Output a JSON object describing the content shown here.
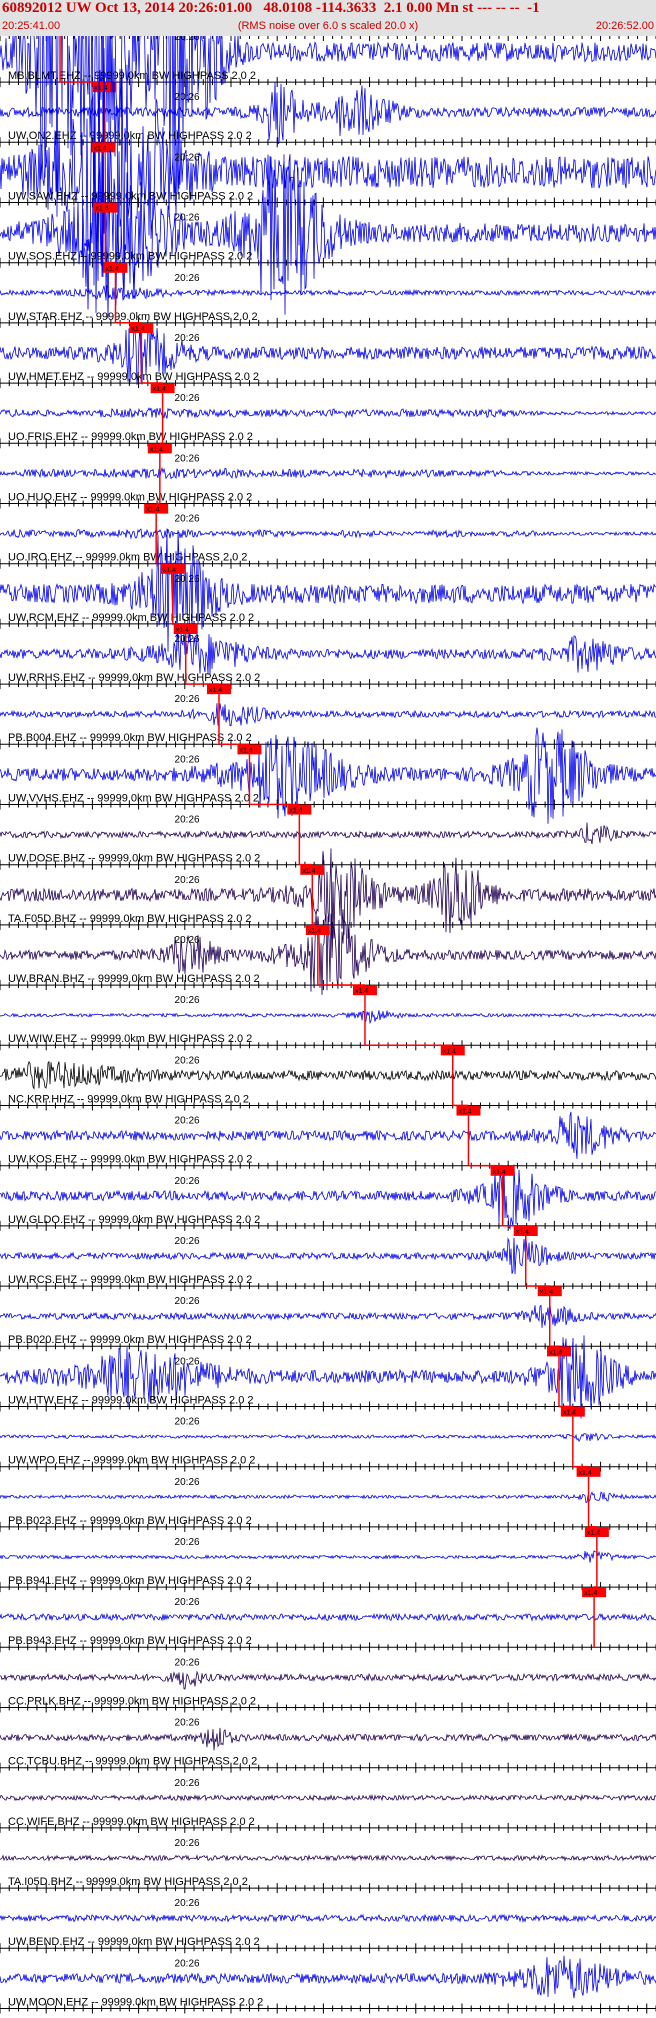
{
  "header": {
    "title": "60892012 UW Oct 13, 2014 20:26:01.00   48.0108 -114.3633  2.1 0.00 Mn st --- -- --  -1",
    "start_time": "20:25:41.00",
    "end_time": "20:26:52.00",
    "subtitle": "(RMS noise over 6.0 s scaled 20.0 x)"
  },
  "chart_data": {
    "type": "line",
    "title": "60892012 UW Oct 13, 2014 20:26:01.00   48.0108 -114.3633  2.1 0.00 Mn st --- -- --  -1",
    "subtitle": "(RMS noise over 6.0 s scaled 20.0 x)",
    "x_range_seconds": [
      0,
      71
    ],
    "x_start_label": "20:25:41.00",
    "x_end_label": "20:26:52.00",
    "minute_label": "20:26",
    "minute_mark_seconds": 19,
    "tick_interval_seconds": 1,
    "pick_label": "x1.4",
    "colors": {
      "blue": "#0000ee",
      "purple": "#220055",
      "black": "#000000",
      "pick": "#ff0000"
    },
    "traces": [
      {
        "station": "MB.BLMT.EHZ",
        "label": "MB.BLMT.EHZ -- 99999.0km BW  HIGHPASS  2.0  2",
        "color": "blue",
        "pick_seconds": 6.5,
        "amp": 6,
        "events": [
          [
            5.5,
            9,
            18
          ],
          [
            11,
            10,
            10
          ],
          [
            19,
            10,
            14
          ]
        ]
      },
      {
        "station": "UW.ON2.EHZ",
        "label": "UW.ON2.EHZ -- 99999.0km BW  HIGHPASS  2.0  2",
        "color": "blue",
        "pick_seconds": 11.3,
        "amp": 3,
        "events": [
          [
            30,
            6,
            6
          ],
          [
            38,
            10,
            5
          ]
        ]
      },
      {
        "station": "UW.SAW.EHZ",
        "label": "UW.SAW.EHZ -- 99999.0km BW  HIGHPASS  2.0  2",
        "color": "blue",
        "pick_seconds": 11.2,
        "amp": 10,
        "events": [
          [
            11.2,
            16,
            8
          ]
        ]
      },
      {
        "station": "UW.SOS.EHZ",
        "label": "UW.SOS.EHZ -- 99999.0km BW  HIGHPASS  2.0  2",
        "color": "blue",
        "pick_seconds": 11.4,
        "amp": 6,
        "events": [
          [
            11.4,
            14,
            8
          ],
          [
            30,
            12,
            8
          ]
        ]
      },
      {
        "station": "UW.STAR.EHZ",
        "label": "UW.STAR.EHZ -- 99999.0km BW  HIGHPASS  2.0  2",
        "color": "blue",
        "pick_seconds": 12.5,
        "amp": 1.5,
        "events": [
          [
            12.3,
            14,
            2
          ]
        ]
      },
      {
        "station": "UW.HMET.EHZ",
        "label": "UW.HMET.EHZ -- 99999.0km BW  HIGHPASS  2.0  2",
        "color": "blue",
        "pick_seconds": 15.3,
        "amp": 4,
        "events": [
          [
            15,
            10,
            4
          ]
        ]
      },
      {
        "station": "UO.FRIS.EHZ",
        "label": "UO.FRIS.EHZ -- 99999.0km BW  HIGHPASS  2.0  2",
        "color": "blue",
        "pick_seconds": 17.6,
        "amp": 1,
        "events": [
          [
            2,
            12,
            1.5
          ],
          [
            12,
            12,
            1.5
          ],
          [
            18,
            14,
            2
          ],
          [
            25,
            10,
            1
          ],
          [
            30,
            12,
            1
          ],
          [
            37,
            10,
            1.5
          ],
          [
            44,
            14,
            1.5
          ],
          [
            50,
            10,
            1
          ],
          [
            54,
            10,
            1
          ]
        ]
      },
      {
        "station": "UO.HUQ.EHZ",
        "label": "UO.HUQ.EHZ -- 99999.0km BW  HIGHPASS  2.0  2",
        "color": "blue",
        "pick_seconds": 17.3,
        "amp": 1,
        "events": [
          [
            4,
            12,
            1.5
          ],
          [
            12,
            12,
            1.5
          ],
          [
            18,
            16,
            2
          ],
          [
            25,
            10,
            1.5
          ],
          [
            32,
            10,
            1.5
          ],
          [
            40,
            12,
            1.5
          ],
          [
            46,
            10,
            1
          ],
          [
            52,
            10,
            1
          ]
        ]
      },
      {
        "station": "UO.IRO.EHZ",
        "label": "UO.IRO.EHZ -- 99999.0km BW  HIGHPASS  2.0  2",
        "color": "blue",
        "pick_seconds": 16.9,
        "amp": 1,
        "events": [
          [
            2,
            8,
            1.5
          ],
          [
            8,
            8,
            1.5
          ],
          [
            14,
            8,
            1.5
          ],
          [
            18,
            10,
            2
          ],
          [
            28,
            8,
            1.5
          ],
          [
            38,
            8,
            1.5
          ],
          [
            48,
            8,
            1.5
          ],
          [
            56,
            8,
            1
          ]
        ]
      },
      {
        "station": "UW.RCM.EHZ",
        "label": "UW.RCM.EHZ -- 99999.0km BW  HIGHPASS  2.0  2",
        "color": "blue",
        "pick_seconds": 18.7,
        "amp": 6,
        "events": [
          [
            18.5,
            10,
            6
          ]
        ]
      },
      {
        "station": "UW.RRHS.EHZ",
        "label": "UW.RRHS.EHZ -- 99999.0km BW  HIGHPASS  2.0  2",
        "color": "blue",
        "pick_seconds": 20.1,
        "amp": 3,
        "events": [
          [
            20.5,
            14,
            4
          ],
          [
            63,
            10,
            3
          ]
        ]
      },
      {
        "station": "PB.B004.EHZ",
        "label": "PB.B004.EHZ -- 99999.0km BW  HIGHPASS  2.0  2",
        "color": "blue",
        "pick_seconds": 23.7,
        "amp": 2,
        "events": [
          [
            24.5,
            10,
            3
          ]
        ]
      },
      {
        "station": "UW.VVHS.EHZ",
        "label": "UW.VVHS.EHZ -- 99999.0km BW  HIGHPASS  2.0  2",
        "color": "blue",
        "pick_seconds": 27.0,
        "amp": 4,
        "events": [
          [
            30,
            16,
            6
          ],
          [
            59,
            12,
            7
          ]
        ]
      },
      {
        "station": "UW.DOSE.BHZ",
        "label": "UW.DOSE.BHZ -- 99999.0km BW  HIGHPASS  2.0  2",
        "color": "purple",
        "pick_seconds": 32.4,
        "amp": 2,
        "events": [
          [
            64,
            5,
            3
          ]
        ]
      },
      {
        "station": "TA.F05D.BHZ",
        "label": "TA.F05D.BHZ -- 99999.0km BW  HIGHPASS  2.0  2",
        "color": "purple",
        "pick_seconds": 33.8,
        "amp": 4,
        "events": [
          [
            36,
            10,
            7
          ],
          [
            49,
            8,
            6
          ]
        ]
      },
      {
        "station": "UW.BRAN.BHZ",
        "label": "UW.BRAN.BHZ -- 99999.0km BW  HIGHPASS  2.0  2",
        "color": "purple",
        "pick_seconds": 34.4,
        "amp": 3,
        "events": [
          [
            20,
            8,
            4
          ],
          [
            35,
            12,
            8
          ]
        ]
      },
      {
        "station": "UW.WIW.EHZ",
        "label": "UW.WIW.EHZ -- 99999.0km BW  HIGHPASS  2.0  2",
        "color": "blue",
        "pick_seconds": 39.5,
        "amp": 1,
        "events": [
          [
            40,
            6,
            4
          ]
        ]
      },
      {
        "station": "NC.KRP.HHZ",
        "label": "NC.KRP.HHZ -- 99999.0km BW  HIGHPASS  2.0  2",
        "color": "black",
        "pick_seconds": 49.0,
        "amp": 3,
        "events": [
          [
            5,
            20,
            2
          ]
        ]
      },
      {
        "station": "UW.KOS.EHZ",
        "label": "UW.KOS.EHZ -- 99999.0km BW  HIGHPASS  2.0  2",
        "color": "blue",
        "pick_seconds": 50.7,
        "amp": 3,
        "events": [
          [
            62,
            10,
            4
          ]
        ]
      },
      {
        "station": "UW.GLDO.EHZ",
        "label": "UW.GLDO.EHZ -- 99999.0km BW  HIGHPASS  2.0  2",
        "color": "blue",
        "pick_seconds": 54.4,
        "amp": 3,
        "events": [
          [
            55,
            10,
            6
          ]
        ]
      },
      {
        "station": "UW.RCS.EHZ",
        "label": "UW.RCS.EHZ -- 99999.0km BW  HIGHPASS  2.0  2",
        "color": "blue",
        "pick_seconds": 56.9,
        "amp": 2,
        "events": [
          [
            56,
            8,
            5
          ]
        ]
      },
      {
        "station": "PB.B020.EHZ",
        "label": "PB.B020.EHZ -- 99999.0km BW  HIGHPASS  2.0  2",
        "color": "blue",
        "pick_seconds": 59.5,
        "amp": 2,
        "events": [
          [
            59,
            8,
            3
          ]
        ]
      },
      {
        "station": "UW.HTW.EHZ",
        "label": "UW.HTW.EHZ -- 99999.0km BW  HIGHPASS  2.0  2",
        "color": "blue",
        "pick_seconds": 60.5,
        "amp": 4,
        "events": [
          [
            14,
            20,
            4
          ],
          [
            62,
            10,
            6
          ]
        ]
      },
      {
        "station": "UW.WPO.EHZ",
        "label": "UW.WPO.EHZ -- 99999.0km BW  HIGHPASS  2.0  2",
        "color": "blue",
        "pick_seconds": 62.0,
        "amp": 1,
        "events": [
          [
            63,
            6,
            2
          ]
        ]
      },
      {
        "station": "PB.B023.EHZ",
        "label": "PB.B023.EHZ -- 99999.0km BW  HIGHPASS  2.0  2",
        "color": "blue",
        "pick_seconds": 63.7,
        "amp": 1,
        "events": [
          [
            64,
            6,
            3
          ]
        ]
      },
      {
        "station": "PB.B941.EHZ",
        "label": "PB.B941.EHZ -- 99999.0km BW  HIGHPASS  2.0  2",
        "color": "blue",
        "pick_seconds": 64.6,
        "amp": 1,
        "events": [
          [
            64,
            6,
            3
          ]
        ]
      },
      {
        "station": "PB.B943.EHZ",
        "label": "PB.B943.EHZ -- 99999.0km BW  HIGHPASS  2.0  2",
        "color": "blue",
        "pick_seconds": 64.3,
        "amp": 2,
        "events": []
      },
      {
        "station": "CC.PRLK.BHZ",
        "label": "CC.PRLK.BHZ -- 99999.0km BW  HIGHPASS  2.0  2",
        "color": "purple",
        "pick_seconds": null,
        "amp": 2,
        "events": [
          [
            20,
            4,
            3
          ]
        ]
      },
      {
        "station": "CC.TCBU.BHZ",
        "label": "CC.TCBU.BHZ -- 99999.0km BW  HIGHPASS  2.0  2",
        "color": "purple",
        "pick_seconds": null,
        "amp": 2,
        "events": [
          [
            23,
            4,
            4
          ]
        ]
      },
      {
        "station": "CC.WIFE.BHZ",
        "label": "CC.WIFE.BHZ -- 99999.0km BW  HIGHPASS  2.0  2",
        "color": "purple",
        "pick_seconds": null,
        "amp": 1.5,
        "events": []
      },
      {
        "station": "TA.I05D.BHZ",
        "label": "TA.I05D.BHZ -- 99999.0km BW  HIGHPASS  2.0  2",
        "color": "purple",
        "pick_seconds": null,
        "amp": 1.5,
        "events": []
      },
      {
        "station": "UW.BEND.EHZ",
        "label": "UW.BEND.EHZ -- 99999.0km BW  HIGHPASS  2.0  2",
        "color": "blue",
        "pick_seconds": null,
        "amp": 2,
        "events": []
      },
      {
        "station": "UW.MOON.EHZ",
        "label": "UW.MOON.EHZ -- 99999.0km BW  HIGHPASS  2.0  2",
        "color": "blue",
        "pick_seconds": null,
        "amp": 3,
        "events": [
          [
            60,
            16,
            4
          ]
        ]
      }
    ]
  }
}
